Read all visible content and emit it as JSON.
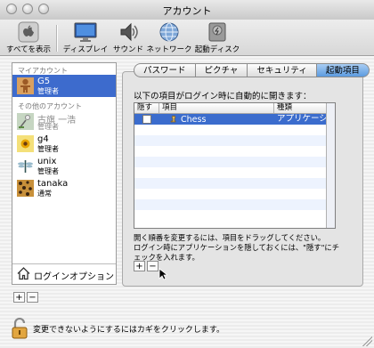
{
  "window": {
    "title": "アカウント"
  },
  "toolbar": {
    "items": [
      {
        "label": "すべてを表示",
        "icon": "apple-logo-icon"
      },
      {
        "label": "ディスプレイ",
        "icon": "display-icon"
      },
      {
        "label": "サウンド",
        "icon": "speaker-icon"
      },
      {
        "label": "ネットワーク",
        "icon": "globe-icon"
      },
      {
        "label": "起動ディスク",
        "icon": "disk-icon"
      }
    ]
  },
  "sidebar": {
    "my_account_header": "マイアカウント",
    "other_accounts_header": "その他のアカウント",
    "my_account": {
      "name": "G5",
      "role": "管理者"
    },
    "others": [
      {
        "name": "古旗 一浩",
        "role": "管理者"
      },
      {
        "name": "g4",
        "role": "管理者"
      },
      {
        "name": "unix",
        "role": "管理者"
      },
      {
        "name": "tanaka",
        "role": "通常"
      }
    ],
    "login_options": "ログインオプション",
    "add": "+",
    "remove": "−"
  },
  "tabs": [
    "パスワード",
    "ピクチャ",
    "セキュリティ",
    "起動項目"
  ],
  "selected_tab": "起動項目",
  "startup": {
    "intro": "以下の項目がログイン時に自動的に開きます：",
    "columns": [
      "隠す",
      "項目",
      "種類"
    ],
    "rows": [
      {
        "name": "Chess",
        "kind": "アプリケーション"
      }
    ],
    "help_line1": "開く順番を変更するには、項目をドラッグしてください。",
    "help_line2": "ログイン時にアプリケーションを隠しておくには、\"隠す\"にチェックを入れます。",
    "add": "+",
    "remove": "−"
  },
  "lock": {
    "text": "変更できないようにするにはカギをクリックします。"
  },
  "colors": {
    "selection": "#3d6bcd",
    "tab_selected": "#5c9be0"
  }
}
